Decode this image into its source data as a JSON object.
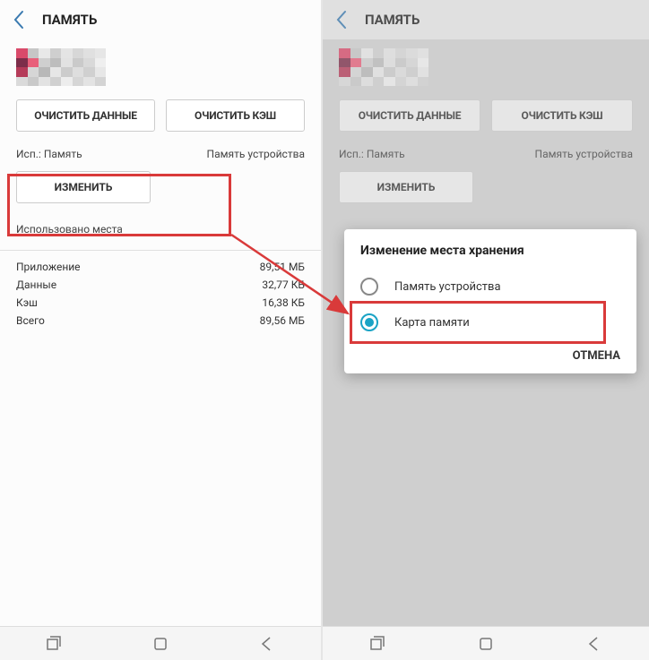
{
  "left": {
    "title": "ПАМЯТЬ",
    "clearData": "ОЧИСТИТЬ ДАННЫЕ",
    "clearCache": "ОЧИСТИТЬ КЭШ",
    "usedLabel": "Исп.: Память",
    "storageValue": "Память устройства",
    "changeBtn": "ИЗМЕНИТЬ",
    "usedSpaceLabel": "Использовано места",
    "rows": [
      {
        "label": "Приложение",
        "value": "89,51 МБ"
      },
      {
        "label": "Данные",
        "value": "32,77 КБ"
      },
      {
        "label": "Кэш",
        "value": "16,38 КБ"
      },
      {
        "label": "Всего",
        "value": "89,56 МБ"
      }
    ]
  },
  "right": {
    "title": "ПАМЯТЬ",
    "clearData": "ОЧИСТИТЬ ДАННЫЕ",
    "clearCache": "ОЧИСТИТЬ КЭШ",
    "usedLabel": "Исп.: Память",
    "storageValue": "Память устройства",
    "changeBtn": "ИЗМЕНИТЬ",
    "dialog": {
      "title": "Изменение места хранения",
      "option1": "Память устройства",
      "option2": "Карта памяти",
      "cancel": "ОТМЕНА"
    }
  }
}
